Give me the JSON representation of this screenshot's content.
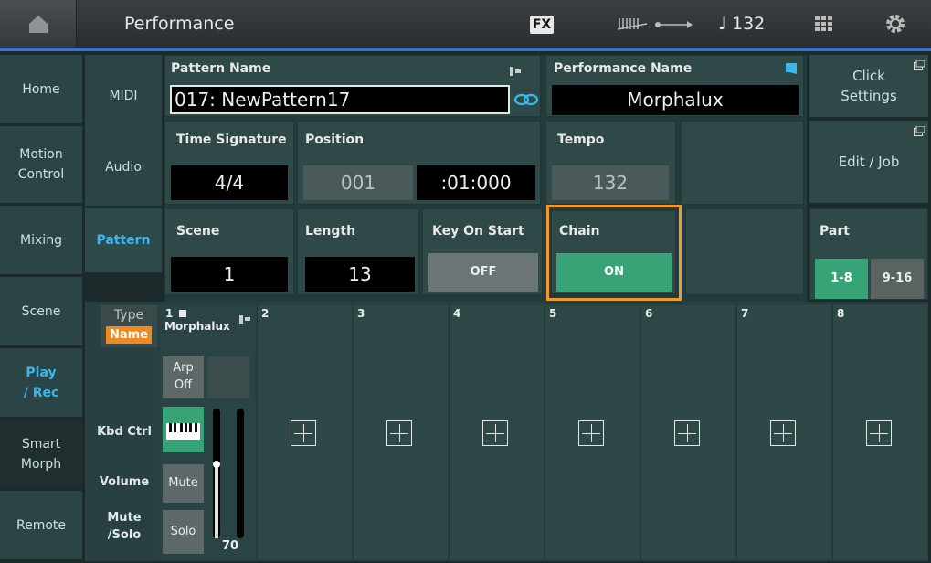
{
  "header": {
    "title": "Performance",
    "fx": "FX",
    "tempo_display": "♩ 132"
  },
  "left_nav": [
    {
      "label": "Home"
    },
    {
      "label": "Motion\nControl"
    },
    {
      "label": "Mixing"
    },
    {
      "label": "Scene"
    },
    {
      "label": "Play\n/ Rec"
    },
    {
      "label": "Smart\nMorph"
    },
    {
      "label": "Remote"
    }
  ],
  "sub_nav": [
    {
      "label": "MIDI"
    },
    {
      "label": "Audio"
    },
    {
      "label": "Pattern"
    }
  ],
  "pattern_name": {
    "label": "Pattern Name",
    "value": "017: NewPattern17"
  },
  "performance_name": {
    "label": "Performance Name",
    "value": "Morphalux"
  },
  "click_settings": {
    "label": "Click\nSettings"
  },
  "edit_job": {
    "label": "Edit / Job"
  },
  "time_signature": {
    "label": "Time Signature",
    "value": "4/4"
  },
  "position": {
    "label": "Position",
    "measure": "001",
    "beat": ":01:000"
  },
  "tempo": {
    "label": "Tempo",
    "value": "132"
  },
  "scene": {
    "label": "Scene",
    "value": "1"
  },
  "length": {
    "label": "Length",
    "value": "13"
  },
  "key_on_start": {
    "label": "Key On Start",
    "value": "OFF"
  },
  "chain": {
    "label": "Chain",
    "value": "ON"
  },
  "part": {
    "label": "Part",
    "range1": "1-8",
    "range2": "9-16"
  },
  "track_labels": {
    "type": "Type",
    "name": "Name",
    "kbd_ctrl": "Kbd Ctrl",
    "volume": "Volume",
    "mute_solo": "Mute\n/Solo"
  },
  "part1": {
    "num": "1",
    "name": "Morphalux",
    "arp": "Arp\nOff",
    "mute": "Mute",
    "solo": "Solo",
    "volume": "70"
  },
  "parts": [
    {
      "num": "2"
    },
    {
      "num": "3"
    },
    {
      "num": "4"
    },
    {
      "num": "5"
    },
    {
      "num": "6"
    },
    {
      "num": "7"
    },
    {
      "num": "8"
    }
  ],
  "colors": {
    "accent_blue": "#39b8ee",
    "chain_highlight": "#f09a28",
    "on_green": "#37a376",
    "name_orange": "#f08a20"
  }
}
